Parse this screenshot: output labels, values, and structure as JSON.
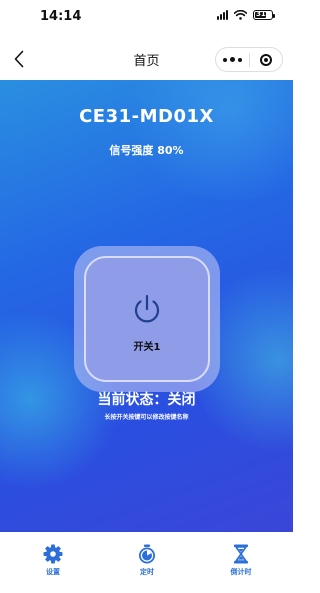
{
  "status_bar": {
    "time": "14:14",
    "battery": "31"
  },
  "nav": {
    "title": "首页"
  },
  "device": {
    "name": "CE31-MD01X",
    "signal": "信号强度 80%"
  },
  "switch": {
    "label": "开关1"
  },
  "status": {
    "text": "当前状态：关闭",
    "hint": "长按开关按键可以修改按键名称"
  },
  "tabs": [
    {
      "label": "设置",
      "icon": "gear-icon"
    },
    {
      "label": "定时",
      "icon": "timer-icon"
    },
    {
      "label": "倒计时",
      "icon": "hourglass-icon"
    }
  ],
  "colors": {
    "accent": "#2c6fd9",
    "gradient_start": "#2a8fe0",
    "gradient_end": "#3a46d8"
  }
}
